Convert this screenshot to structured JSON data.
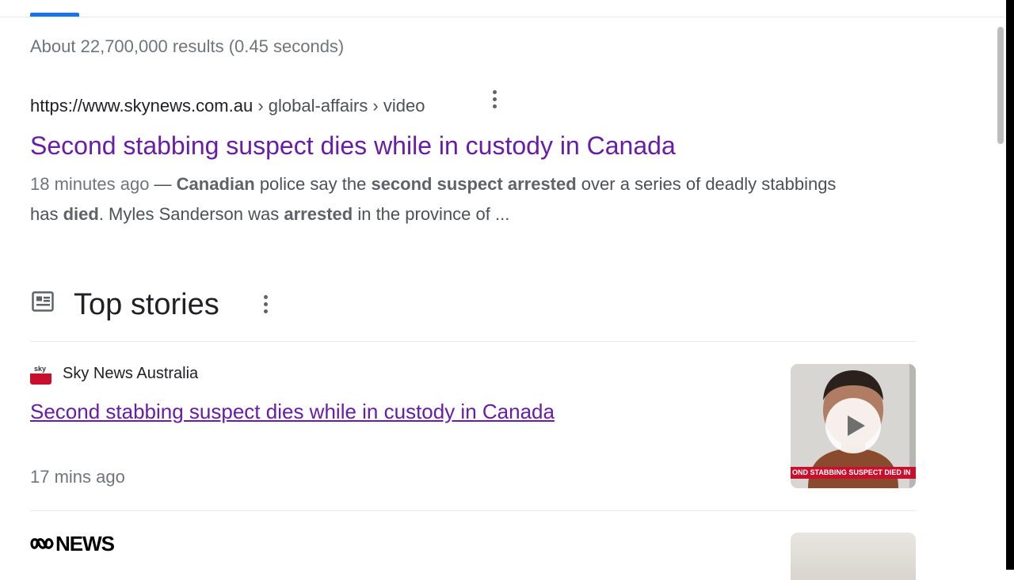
{
  "results_stats": "About 22,700,000 results (0.45 seconds)",
  "result": {
    "url_domain": "https://www.skynews.com.au",
    "url_path": " › global-affairs › video",
    "title": "Second stabbing suspect dies while in custody in Canada",
    "date": "18 minutes ago",
    "snippet_parts": [
      {
        "t": " — ",
        "b": false
      },
      {
        "t": "Canadian",
        "b": true
      },
      {
        "t": " police say the ",
        "b": false
      },
      {
        "t": "second suspect arrested",
        "b": true
      },
      {
        "t": " over a series of deadly stabbings has ",
        "b": false
      },
      {
        "t": "died",
        "b": true
      },
      {
        "t": ". Myles Sanderson was ",
        "b": false
      },
      {
        "t": "arrested",
        "b": true
      },
      {
        "t": " in the province of ...",
        "b": false
      }
    ]
  },
  "top_stories": {
    "heading": "Top stories",
    "icon": "newspaper-icon",
    "stories": [
      {
        "source": "Sky News Australia",
        "favicon_text": "sky",
        "title": "Second stabbing suspect dies while in custody in Canada",
        "time": "17 mins ago",
        "thumb_caption": "OND STABBING SUSPECT DIED IN",
        "thumb_icon": "play-icon"
      }
    ],
    "next_source_logo_text": "NEWS"
  },
  "colors": {
    "link_visited": "#681da8",
    "accent": "#1a73e8",
    "caption_red": "#c8102e"
  }
}
